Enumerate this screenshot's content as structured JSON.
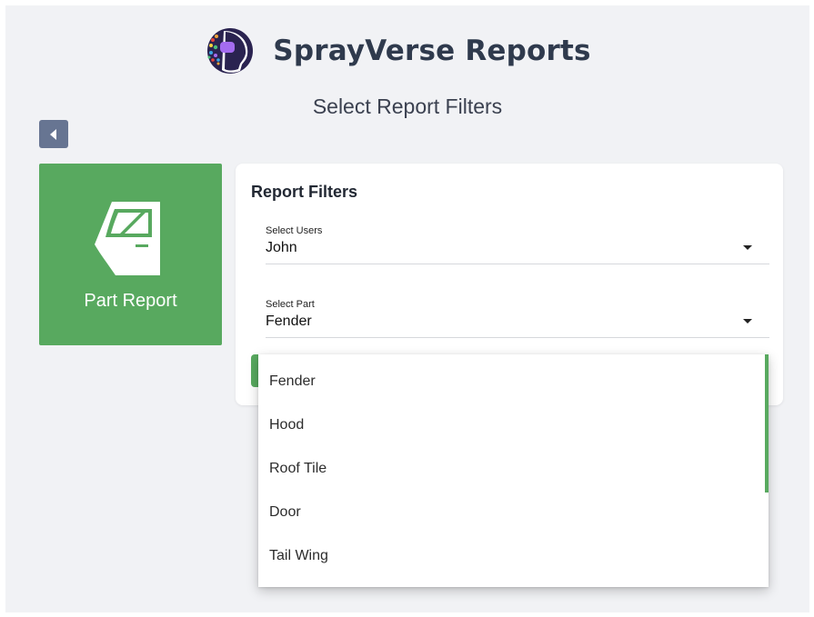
{
  "header": {
    "app_title": "SprayVerse Reports",
    "logo_icon": "sprayverse-face-logo-icon",
    "subtitle": "Select Report Filters"
  },
  "nav": {
    "back_icon": "triangle-left-icon"
  },
  "report_tile": {
    "label": "Part Report",
    "icon": "car-door-icon",
    "color": "#58a95f"
  },
  "filters": {
    "title": "Report Filters",
    "users": {
      "label": "Select Users",
      "value": "John"
    },
    "part": {
      "label": "Select Part",
      "value": "Fender"
    }
  },
  "part_dropdown": {
    "options": [
      "Fender",
      "Hood",
      "Roof Tile",
      "Door",
      "Tail Wing"
    ]
  },
  "colors": {
    "accent_green": "#58a95f",
    "back_button": "#677592",
    "title_text": "#2f3a4d",
    "background": "#f1f2f5"
  }
}
